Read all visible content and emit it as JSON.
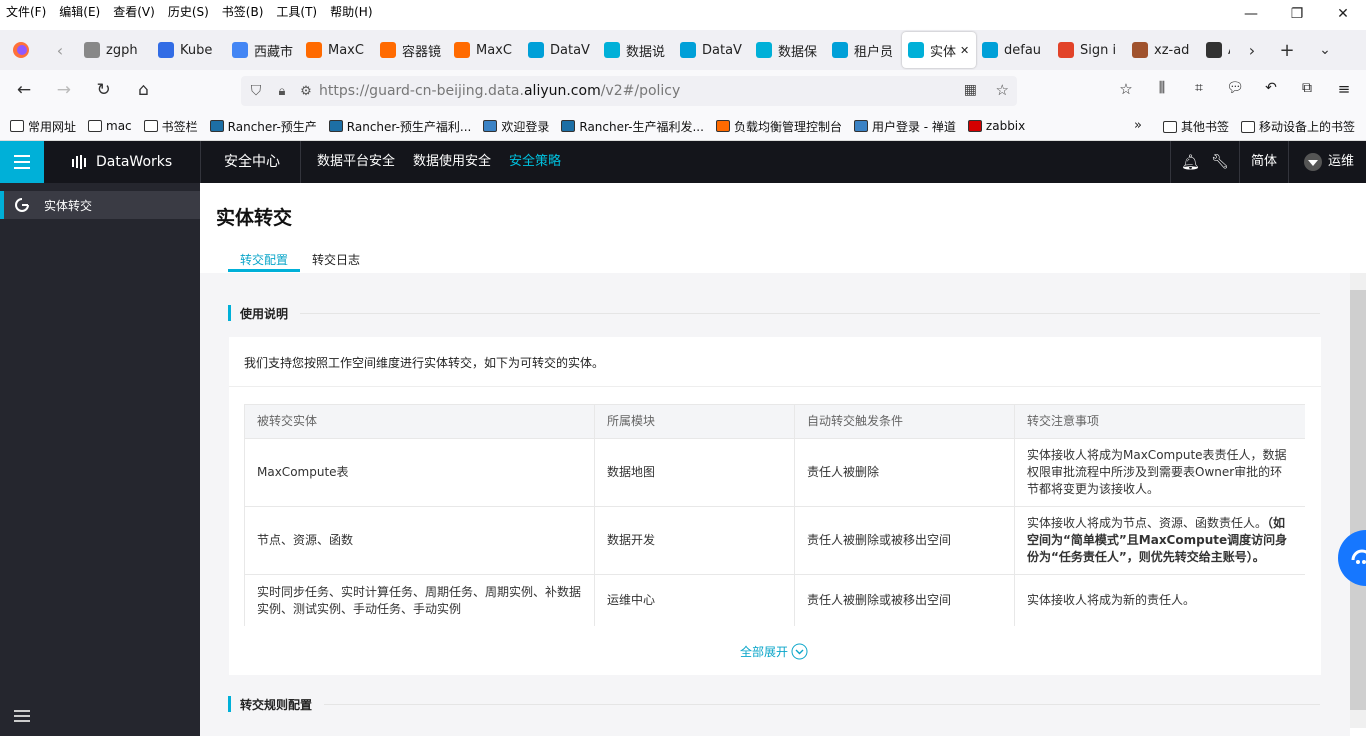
{
  "menubar": [
    "文件(F)",
    "编辑(E)",
    "查看(V)",
    "历史(S)",
    "书签(B)",
    "工具(T)",
    "帮助(H)"
  ],
  "window_controls": {
    "minimize": "—",
    "restore": "❐",
    "close": "✕"
  },
  "tabs": [
    {
      "label": "zgph",
      "icon": "page-icon",
      "color": "#888888"
    },
    {
      "label": "Kube",
      "icon": "kubernetes-icon",
      "color": "#326ce5"
    },
    {
      "label": "西藏市",
      "icon": "chrome-icon",
      "color": "#4285f4"
    },
    {
      "label": "MaxC",
      "icon": "aliyun-icon",
      "color": "#ff6a00"
    },
    {
      "label": "容器镜",
      "icon": "aliyun-icon",
      "color": "#ff6a00"
    },
    {
      "label": "MaxC",
      "icon": "aliyun-icon",
      "color": "#ff6a00"
    },
    {
      "label": "DataV",
      "icon": "dataworks-icon",
      "color": "#00a0d8"
    },
    {
      "label": "数据说",
      "icon": "cube-icon",
      "color": "#00b0d8"
    },
    {
      "label": "DataV",
      "icon": "dataworks-icon",
      "color": "#00a0d8"
    },
    {
      "label": "数据保",
      "icon": "cube-icon",
      "color": "#00b0d8"
    },
    {
      "label": "租户员",
      "icon": "dataworks-icon",
      "color": "#00a0d8"
    },
    {
      "label": "实体",
      "icon": "cube-icon",
      "color": "#00b0d8",
      "active": true
    },
    {
      "label": "defau",
      "icon": "dataworks-icon",
      "color": "#00a0d8"
    },
    {
      "label": "Sign i",
      "icon": "gitlab-icon",
      "color": "#e24329"
    },
    {
      "label": "xz-ad",
      "icon": "avatar-icon",
      "color": "#a0522d"
    },
    {
      "label": "A",
      "icon": "helm-icon",
      "color": "#333333"
    }
  ],
  "tab_close": "✕",
  "new_tab": "+",
  "url": {
    "prefix": "https://guard-cn-beijing.data.",
    "domain": "aliyun.com",
    "suffix": "/v2#/policy"
  },
  "bookmarks": [
    {
      "label": "常用网址",
      "icon": "folder-icon"
    },
    {
      "label": "mac",
      "icon": "folder-icon"
    },
    {
      "label": "书签栏",
      "icon": "folder-icon"
    },
    {
      "label": "Rancher-预生产",
      "icon": "rancher-icon"
    },
    {
      "label": "Rancher-预生产福利...",
      "icon": "rancher-icon"
    },
    {
      "label": "欢迎登录",
      "icon": "globe-icon"
    },
    {
      "label": "Rancher-生产福利发...",
      "icon": "rancher-icon"
    },
    {
      "label": "负载均衡管理控制台",
      "icon": "aliyun-icon"
    },
    {
      "label": "用户登录 - 禅道",
      "icon": "globe-icon"
    },
    {
      "label": "zabbix",
      "icon": "zabbix-icon"
    }
  ],
  "bookmarks_right": [
    {
      "label": "其他书签",
      "icon": "folder-icon"
    },
    {
      "label": "移动设备上的书签",
      "icon": "phone-icon"
    }
  ],
  "app": {
    "brand": "DataWorks",
    "section": "安全中心",
    "nav": [
      "数据平台安全",
      "数据使用安全",
      "安全策略"
    ],
    "active_nav": "安全策略",
    "lang": "简体",
    "user": "运维",
    "accent": "#00b0d8"
  },
  "sidebar": {
    "items": [
      {
        "label": "实体转交"
      }
    ]
  },
  "page": {
    "title": "实体转交",
    "tabs": [
      "转交配置",
      "转交日志"
    ],
    "section1": "使用说明",
    "description": "我们支持您按照工作空间维度进行实体转交，如下为可转交的实体。",
    "table": {
      "headers": [
        "被转交实体",
        "所属模块",
        "自动转交触发条件",
        "转交注意事项"
      ],
      "rows": [
        [
          "MaxCompute表",
          "数据地图",
          "责任人被删除",
          "实体接收人将成为MaxCompute表责任人，数据权限审批流程中所涉及到需要表Owner审批的环节都将变更为该接收人。"
        ],
        [
          "节点、资源、函数",
          "数据开发",
          "责任人被删除或被移出空间",
          "实体接收人将成为节点、资源、函数责任人。"
        ],
        [
          "实时同步任务、实时计算任务、周期任务、周期实例、补数据实例、测试实例、手动任务、手动实例",
          "运维中心",
          "责任人被删除或被移出空间",
          "实体接收人将成为新的责任人。"
        ]
      ],
      "row2_bold": "（如空间为“简单模式”且MaxCompute调度访问身份为“任务责任人”，则优先转交给主账号）。"
    },
    "expand": "全部展开",
    "section2": "转交规则配置"
  }
}
